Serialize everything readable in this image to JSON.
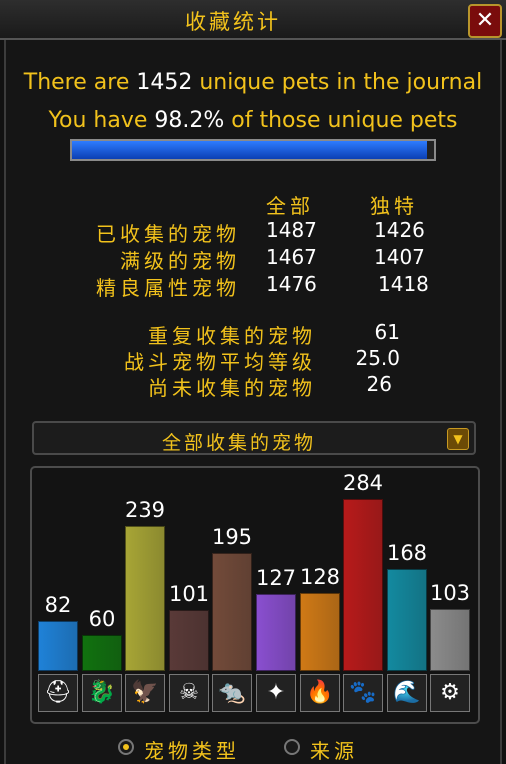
{
  "window": {
    "title": "收藏统计",
    "close_label": "✕"
  },
  "summary": {
    "line1_prefix": "There are ",
    "unique_total": "1452",
    "line1_suffix": " unique pets in the journal",
    "line2_prefix": "You have ",
    "percent": "98.2%",
    "line2_suffix": " of those unique pets",
    "progress_fraction": 0.982
  },
  "stats": {
    "col_all": "全部",
    "col_unique": "独特",
    "rows": [
      {
        "label": "已收集的宠物",
        "all": "1487",
        "unique": "1426"
      },
      {
        "label": "满级的宠物",
        "all": "1467",
        "unique": "1407"
      },
      {
        "label": "精良属性宠物",
        "all": "1476",
        "unique": "1418"
      }
    ],
    "extra": [
      {
        "label": "重复收集的宠物",
        "value": "61"
      },
      {
        "label": "战斗宠物平均等级",
        "value": "25.0"
      },
      {
        "label": "尚未收集的宠物",
        "value": "26"
      }
    ]
  },
  "dropdown": {
    "selected": "全部收集的宠物"
  },
  "chart_data": {
    "type": "bar",
    "categories": [
      "humanoid",
      "dragonkin",
      "flying",
      "undead",
      "critter",
      "magic",
      "elemental",
      "beast",
      "aquatic",
      "mechanical"
    ],
    "values": [
      82,
      60,
      239,
      101,
      195,
      127,
      128,
      284,
      168,
      103
    ],
    "colors": [
      "#1f82d8",
      "#11720f",
      "#a8a636",
      "#5a3a38",
      "#734b3a",
      "#8a4fd0",
      "#d07a16",
      "#b81a1a",
      "#138aa0",
      "#8c8c8c"
    ],
    "icons": [
      "helmet-icon",
      "dragon-icon",
      "bird-icon",
      "skull-icon",
      "critter-icon",
      "magic-star-icon",
      "flame-icon",
      "paw-icon",
      "water-icon",
      "gear-icon"
    ],
    "icon_glyphs": [
      "⛑",
      "🐉",
      "🦅",
      "☠",
      "🐀",
      "✦",
      "🔥",
      "🐾",
      "🌊",
      "⚙"
    ],
    "ylim": [
      0,
      284
    ]
  },
  "radios": [
    {
      "label": "宠物类型",
      "selected": true
    },
    {
      "label": "来源",
      "selected": false
    }
  ]
}
